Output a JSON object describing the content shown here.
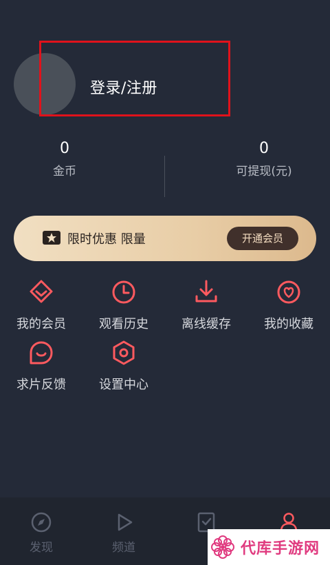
{
  "profile": {
    "login_label": "登录/注册"
  },
  "stats": {
    "coins": {
      "value": "0",
      "label": "金币"
    },
    "withdrawable": {
      "value": "0",
      "label": "可提现(元)"
    }
  },
  "vip_banner": {
    "text": "限时优惠 限量",
    "button": "开通会员",
    "icon": "ticket-star-icon"
  },
  "menu": [
    {
      "label": "我的会员",
      "icon": "diamond-icon"
    },
    {
      "label": "观看历史",
      "icon": "clock-icon"
    },
    {
      "label": "离线缓存",
      "icon": "download-icon"
    },
    {
      "label": "我的收藏",
      "icon": "heart-icon"
    },
    {
      "label": "求片反馈",
      "icon": "chat-smile-icon"
    },
    {
      "label": "设置中心",
      "icon": "settings-hexagon-icon"
    }
  ],
  "tabbar": [
    {
      "label": "发现",
      "icon": "compass-icon"
    },
    {
      "label": "频道",
      "icon": "play-icon"
    },
    {
      "label": "",
      "icon": "checklist-icon"
    },
    {
      "label": "",
      "icon": "user-icon"
    }
  ],
  "watermark": {
    "text": "代库手游网"
  },
  "colors": {
    "background": "#242a38",
    "accent": "#ff5a5f",
    "banner_gold": "#e8cda6",
    "highlight_red": "#e0121b"
  }
}
